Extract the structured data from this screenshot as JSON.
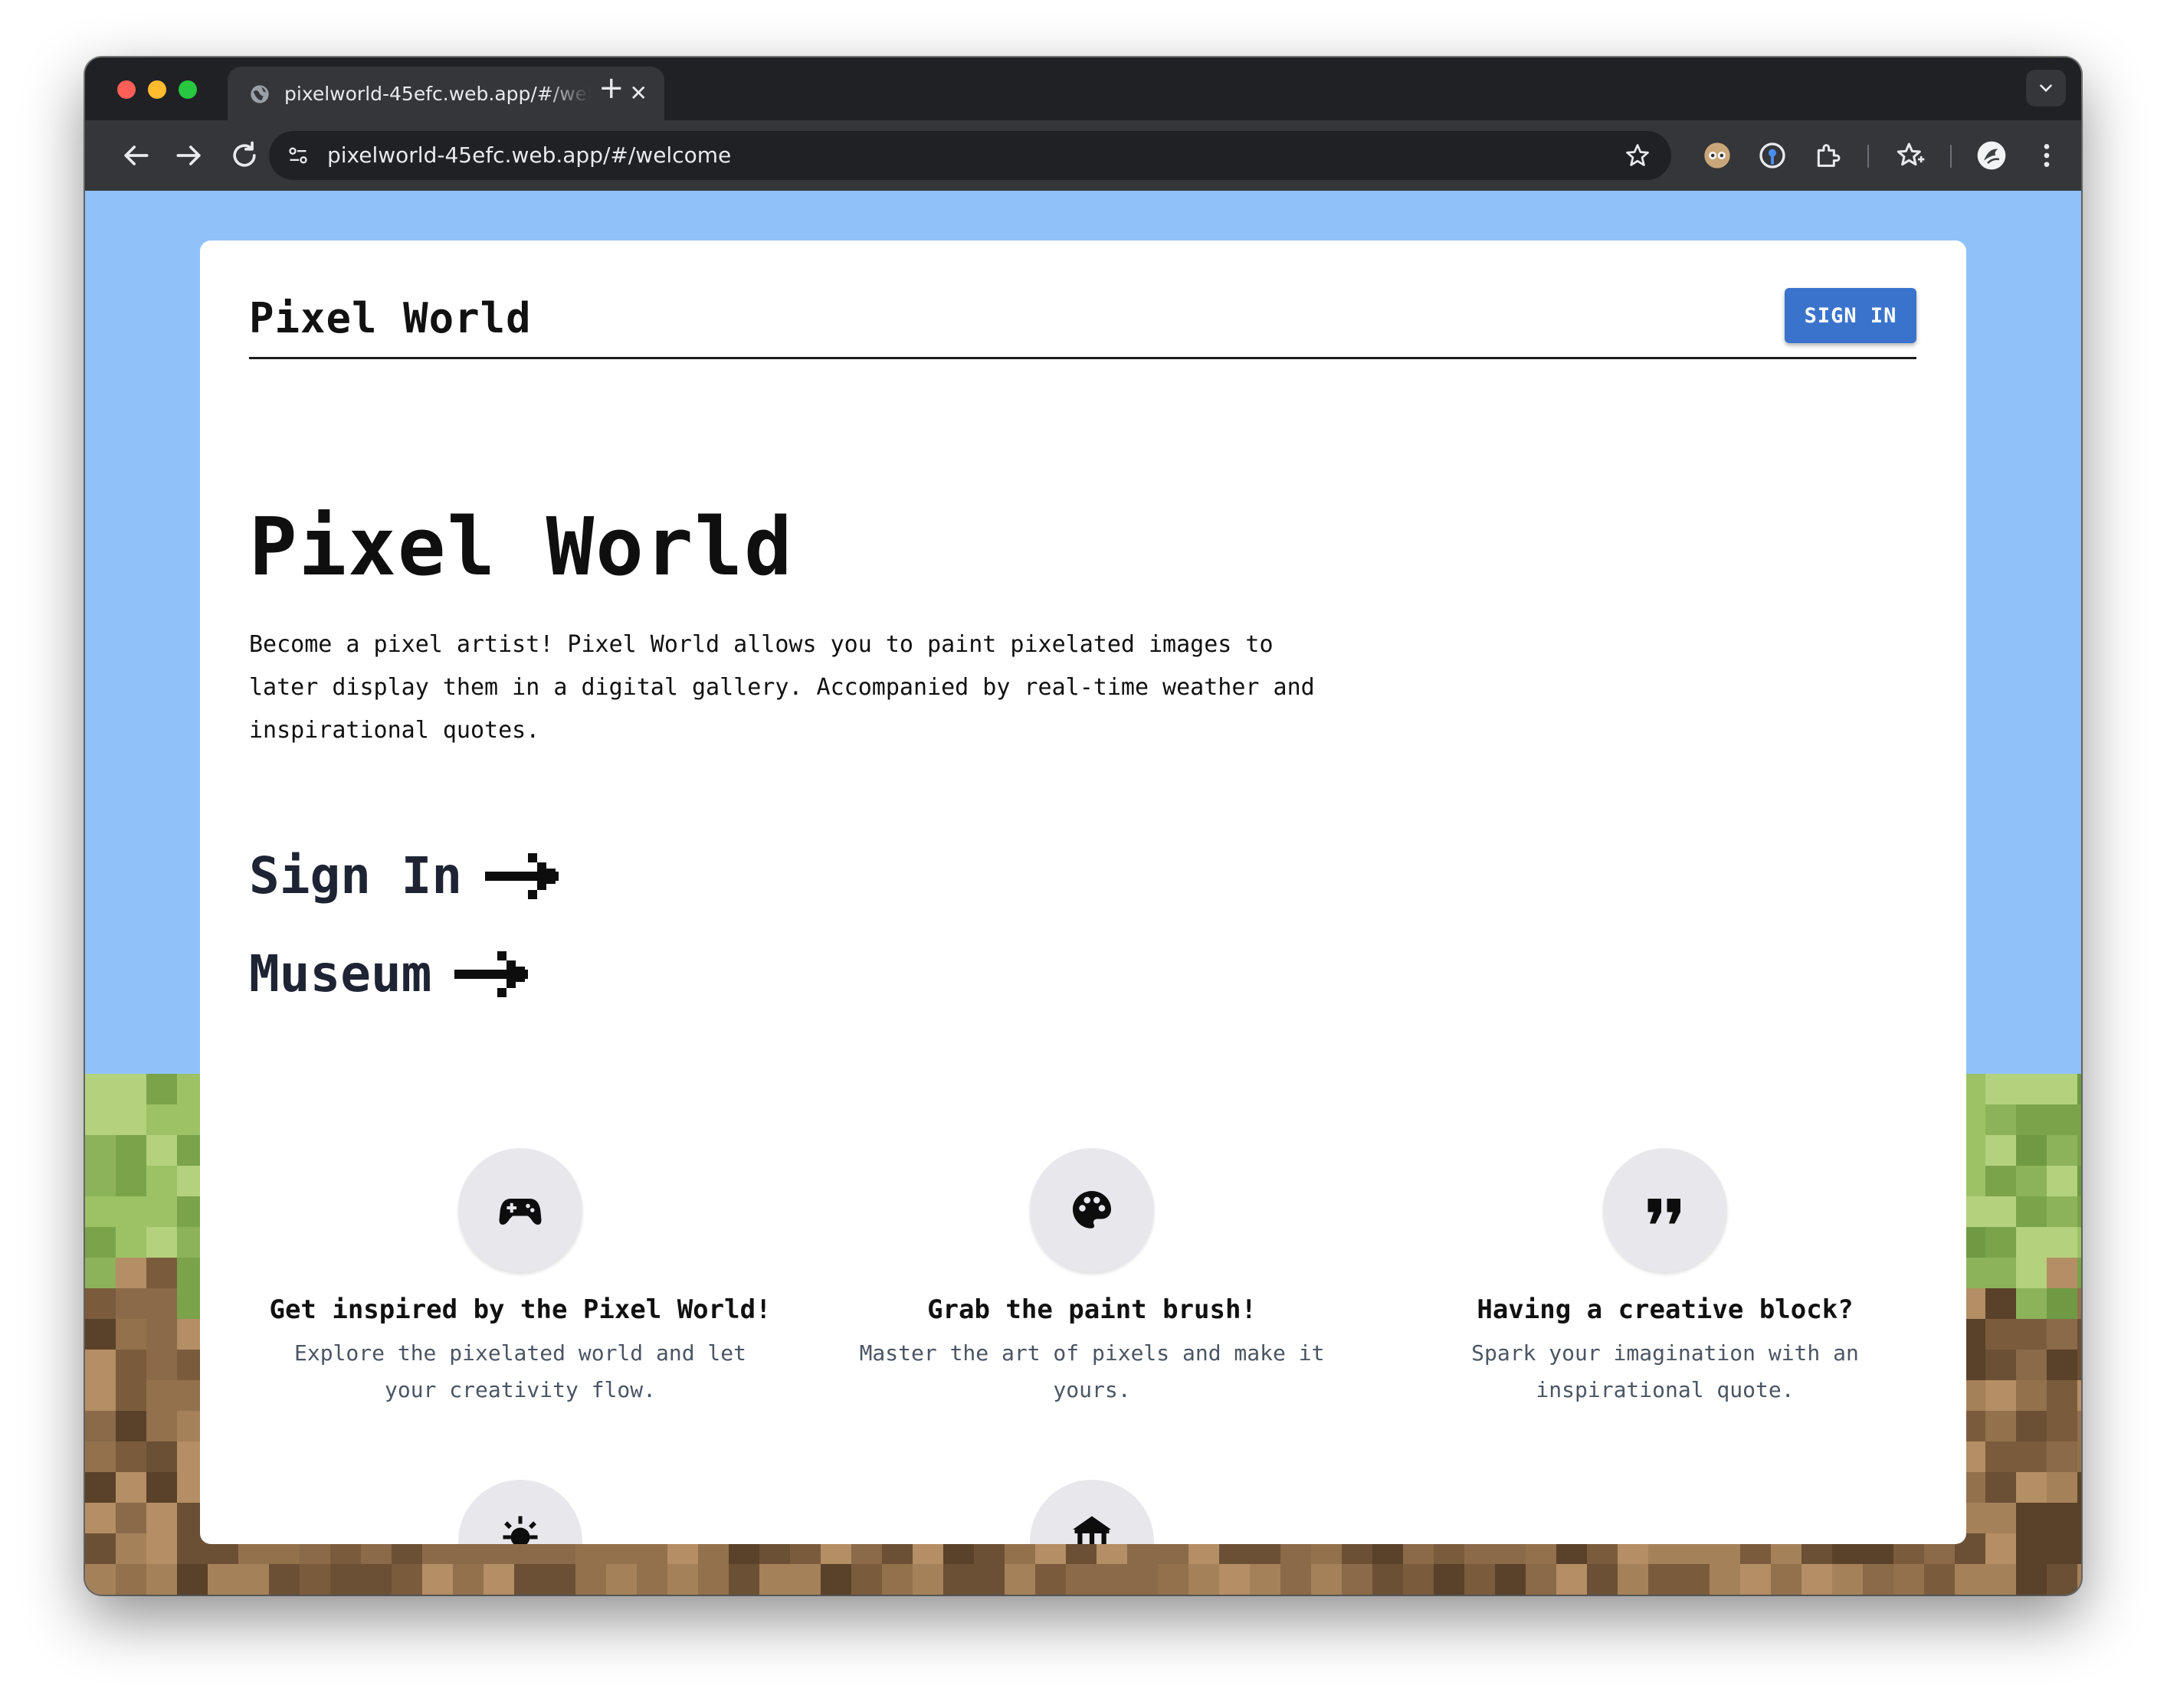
{
  "browser": {
    "tab_title": "pixelworld-45efc.web.app/#/welcome",
    "new_tab_symbol": "+",
    "close_symbol": "✕",
    "url": "pixelworld-45efc.web.app/#/welcome"
  },
  "header": {
    "brand": "Pixel World",
    "signin_label": "SIGN IN"
  },
  "hero": {
    "title": "Pixel World",
    "description": "Become a pixel artist! Pixel World allows you to paint pixelated images to later display them in a digital gallery. Accompanied by real-time weather and inspirational quotes."
  },
  "links": {
    "signin": "Sign In",
    "museum": "Museum"
  },
  "features": [
    {
      "icon": "gamepad-icon",
      "title": "Get inspired by the Pixel World!",
      "text": "Explore the pixelated world and let your creativity flow."
    },
    {
      "icon": "palette-icon",
      "title": "Grab the paint brush!",
      "text": "Master the art of pixels and make it yours."
    },
    {
      "icon": "quote-icon",
      "title": "Having a creative block?",
      "text": "Spark your imagination with an inspirational quote."
    }
  ],
  "partial_feature_icons": [
    "sun-icon",
    "museum-icon"
  ],
  "colors": {
    "sky": "#90c2f9",
    "accent": "#3a73cc",
    "card": "#ffffff",
    "browser_dark": "#202124"
  }
}
